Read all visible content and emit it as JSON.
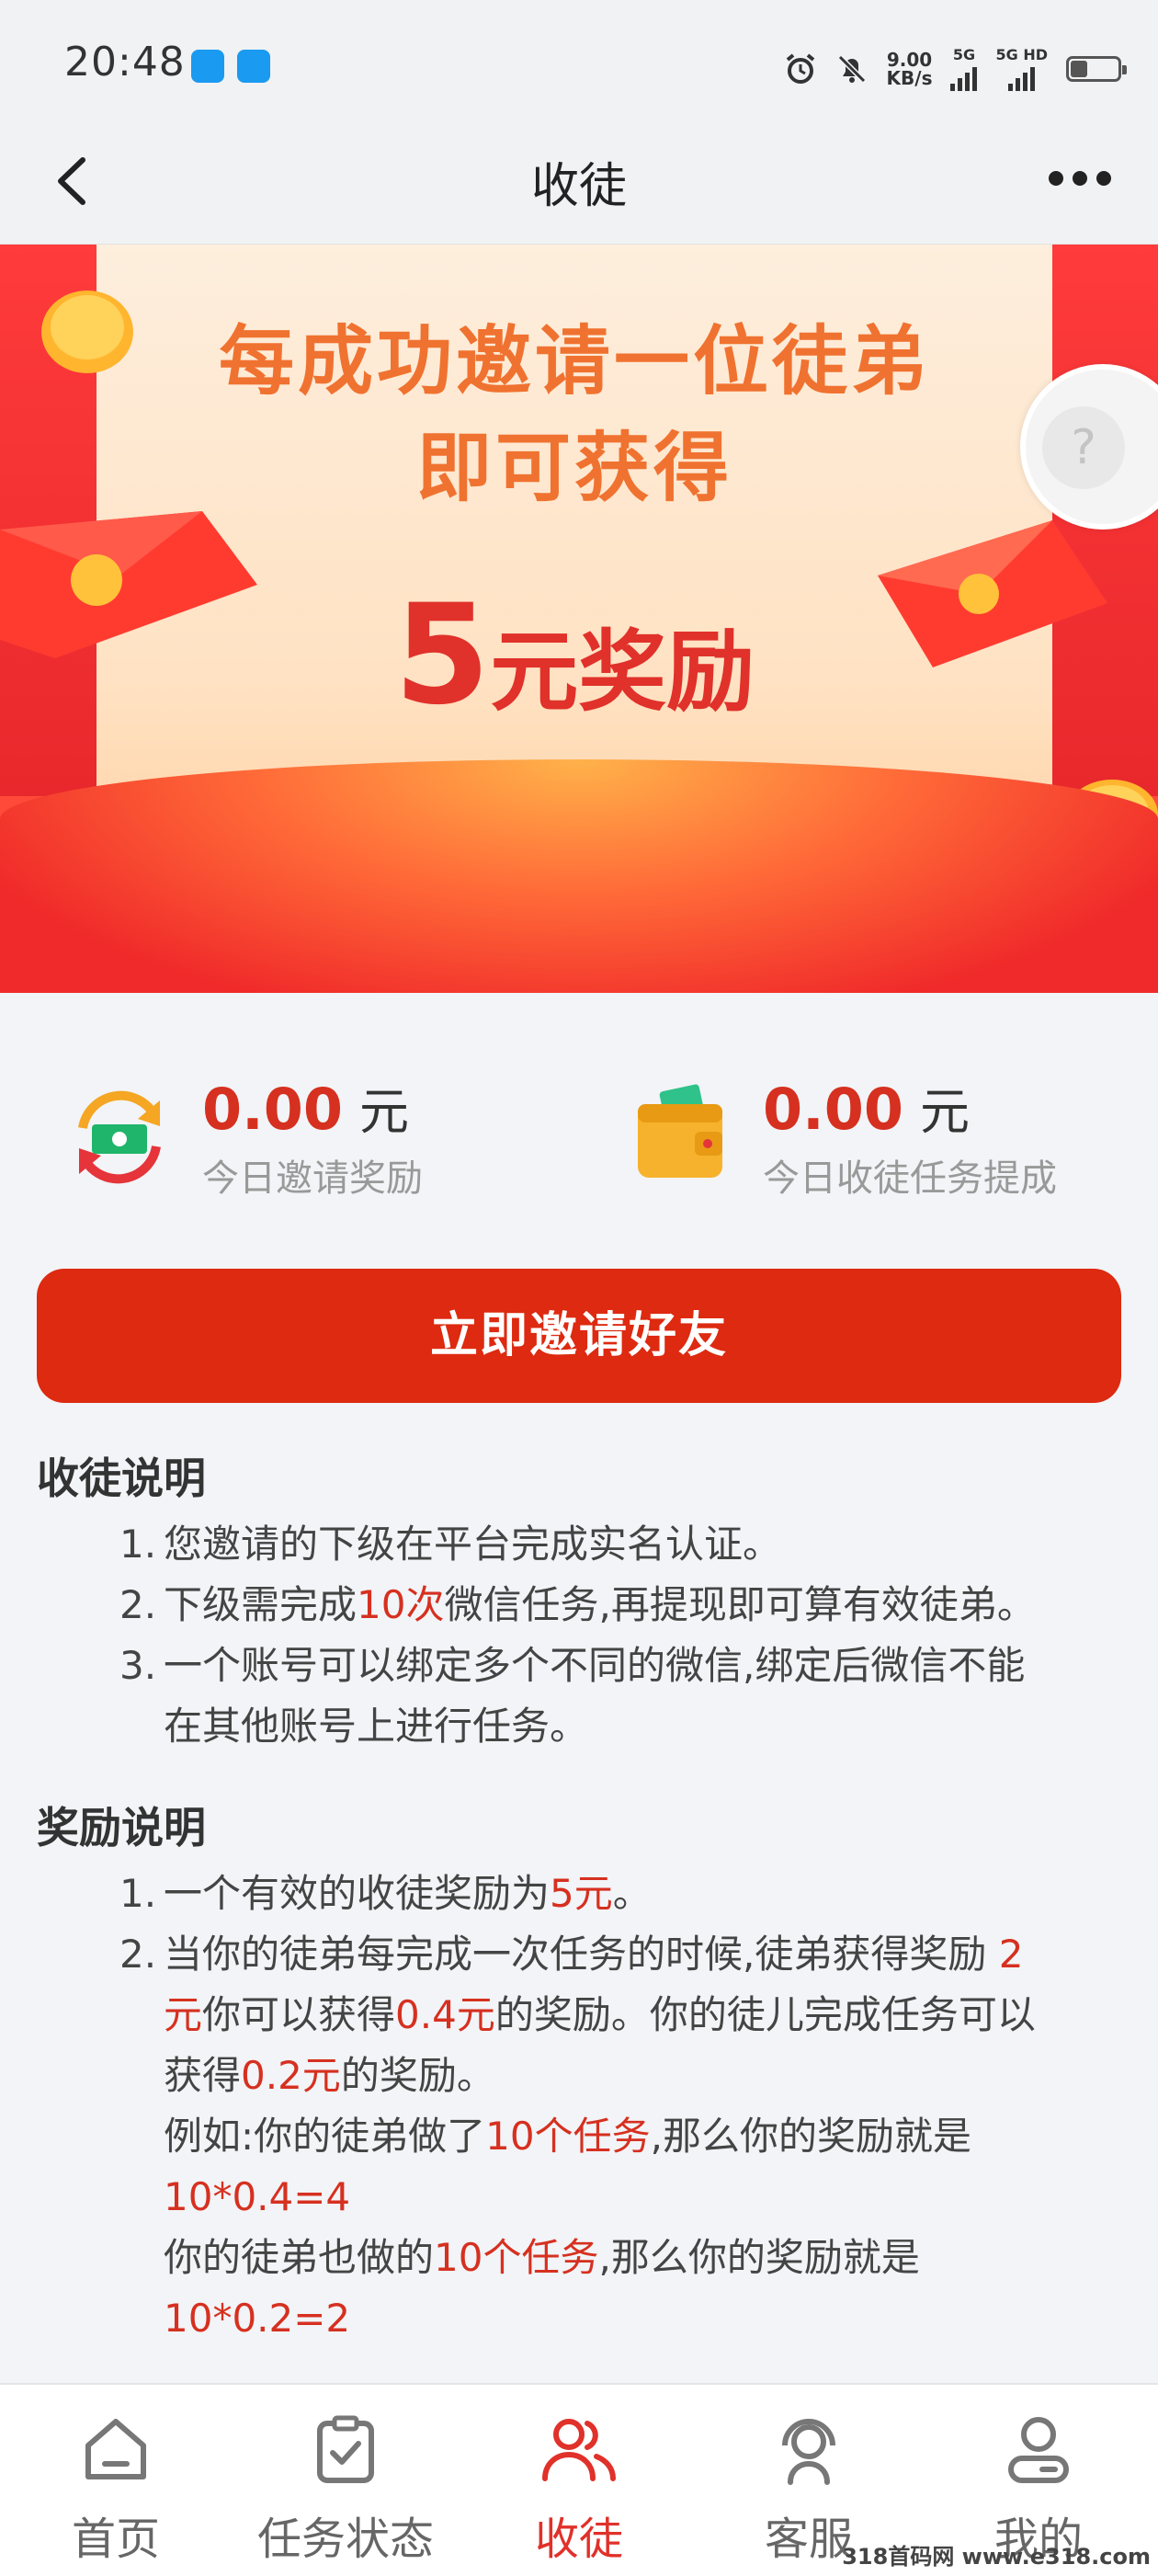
{
  "status_bar": {
    "time": "20:48",
    "speed_value": "9.00",
    "speed_unit": "KB/s",
    "signal1": "5G",
    "signal2": "5G HD"
  },
  "nav": {
    "title": "收徒",
    "back_icon": "chevron-left-icon",
    "more_icon": "more-icon"
  },
  "banner": {
    "line1": "每成功邀请一位徒弟",
    "line2": "即可获得",
    "reward_amount": "5",
    "reward_text": "元奖励",
    "help_symbol": "?"
  },
  "stats": [
    {
      "value": "0.00",
      "unit": "元",
      "label": "今日邀请奖励",
      "icon": "money-refresh-icon"
    },
    {
      "value": "0.00",
      "unit": "元",
      "label": "今日收徒任务提成",
      "icon": "wallet-icon"
    }
  ],
  "invite_button": "立即邀请好友",
  "apprentice_rules": {
    "title": "收徒说明",
    "items": [
      {
        "num": "1.",
        "text": "您邀请的下级在平台完成实名认证。"
      },
      {
        "num": "2.",
        "pre": "下级需完成",
        "hl": "10次",
        "post": "微信任务,再提现即可算有效徒弟。"
      },
      {
        "num": "3.",
        "line1": "一个账号可以绑定多个不同的微信,绑定后微信不能",
        "line2": "在其他账号上进行任务。"
      }
    ]
  },
  "reward_rules": {
    "title": "奖励说明",
    "item1": {
      "num": "1.",
      "pre": "一个有效的收徒奖励为",
      "hl": "5元",
      "post": "。"
    },
    "item2": {
      "num": "2.",
      "l1_pre": "当你的徒弟每完成一次任务的时候,徒弟获得奖励 ",
      "l1_hl": "2",
      "l2_hl1": "元",
      "l2_mid": "你可以获得",
      "l2_hl2": "0.4元",
      "l2_post": "的奖励。你的徒儿完成任务可以",
      "l3_pre": "获得",
      "l3_hl": "0.2元",
      "l3_post": "的奖励。",
      "l4_pre": "例如:你的徒弟做了",
      "l4_hl": "10个任务",
      "l4_post": ",那么你的奖励就是",
      "l5_hl": "10*0.4=4",
      "l6_pre": "你的徒弟也做的",
      "l6_hl": "10个任务",
      "l6_post": ",那么你的奖励就是",
      "l7_hl": "10*0.2=2"
    }
  },
  "tabs": [
    {
      "label": "首页",
      "icon": "home-icon",
      "active": false
    },
    {
      "label": "任务状态",
      "icon": "clipboard-check-icon",
      "active": false
    },
    {
      "label": "收徒",
      "icon": "users-icon",
      "active": true
    },
    {
      "label": "客服",
      "icon": "headset-icon",
      "active": false
    },
    {
      "label": "我的",
      "icon": "user-icon",
      "active": false
    }
  ],
  "watermark": "318首码网 www.e318.com",
  "colors": {
    "accent": "#dd2a10",
    "highlight": "#d63020",
    "banner_text": "#f07230",
    "active_tab": "#e0312a"
  }
}
